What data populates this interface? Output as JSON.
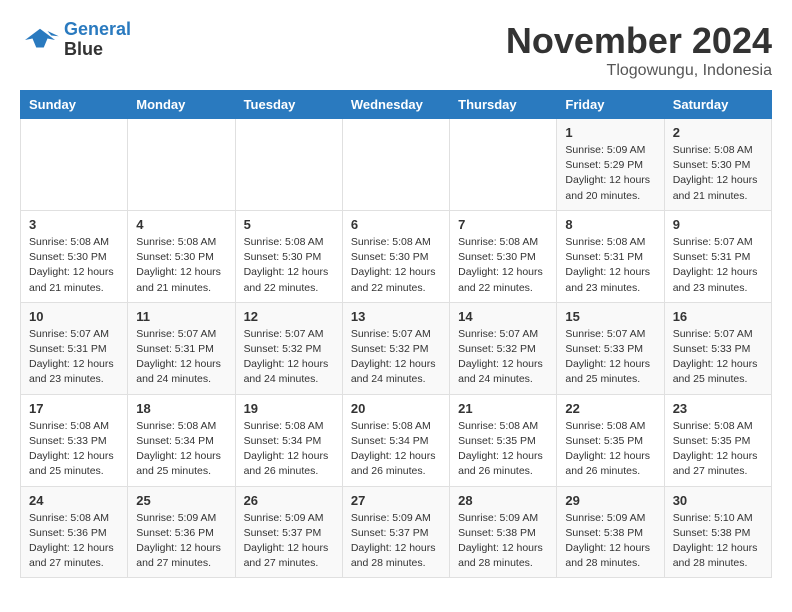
{
  "header": {
    "logo_line1": "General",
    "logo_line2": "Blue",
    "month_title": "November 2024",
    "location": "Tlogowungu, Indonesia"
  },
  "days_of_week": [
    "Sunday",
    "Monday",
    "Tuesday",
    "Wednesday",
    "Thursday",
    "Friday",
    "Saturday"
  ],
  "weeks": [
    {
      "days": [
        {
          "number": "",
          "info": ""
        },
        {
          "number": "",
          "info": ""
        },
        {
          "number": "",
          "info": ""
        },
        {
          "number": "",
          "info": ""
        },
        {
          "number": "",
          "info": ""
        },
        {
          "number": "1",
          "info": "Sunrise: 5:09 AM\nSunset: 5:29 PM\nDaylight: 12 hours\nand 20 minutes."
        },
        {
          "number": "2",
          "info": "Sunrise: 5:08 AM\nSunset: 5:30 PM\nDaylight: 12 hours\nand 21 minutes."
        }
      ]
    },
    {
      "days": [
        {
          "number": "3",
          "info": "Sunrise: 5:08 AM\nSunset: 5:30 PM\nDaylight: 12 hours\nand 21 minutes."
        },
        {
          "number": "4",
          "info": "Sunrise: 5:08 AM\nSunset: 5:30 PM\nDaylight: 12 hours\nand 21 minutes."
        },
        {
          "number": "5",
          "info": "Sunrise: 5:08 AM\nSunset: 5:30 PM\nDaylight: 12 hours\nand 22 minutes."
        },
        {
          "number": "6",
          "info": "Sunrise: 5:08 AM\nSunset: 5:30 PM\nDaylight: 12 hours\nand 22 minutes."
        },
        {
          "number": "7",
          "info": "Sunrise: 5:08 AM\nSunset: 5:30 PM\nDaylight: 12 hours\nand 22 minutes."
        },
        {
          "number": "8",
          "info": "Sunrise: 5:08 AM\nSunset: 5:31 PM\nDaylight: 12 hours\nand 23 minutes."
        },
        {
          "number": "9",
          "info": "Sunrise: 5:07 AM\nSunset: 5:31 PM\nDaylight: 12 hours\nand 23 minutes."
        }
      ]
    },
    {
      "days": [
        {
          "number": "10",
          "info": "Sunrise: 5:07 AM\nSunset: 5:31 PM\nDaylight: 12 hours\nand 23 minutes."
        },
        {
          "number": "11",
          "info": "Sunrise: 5:07 AM\nSunset: 5:31 PM\nDaylight: 12 hours\nand 24 minutes."
        },
        {
          "number": "12",
          "info": "Sunrise: 5:07 AM\nSunset: 5:32 PM\nDaylight: 12 hours\nand 24 minutes."
        },
        {
          "number": "13",
          "info": "Sunrise: 5:07 AM\nSunset: 5:32 PM\nDaylight: 12 hours\nand 24 minutes."
        },
        {
          "number": "14",
          "info": "Sunrise: 5:07 AM\nSunset: 5:32 PM\nDaylight: 12 hours\nand 24 minutes."
        },
        {
          "number": "15",
          "info": "Sunrise: 5:07 AM\nSunset: 5:33 PM\nDaylight: 12 hours\nand 25 minutes."
        },
        {
          "number": "16",
          "info": "Sunrise: 5:07 AM\nSunset: 5:33 PM\nDaylight: 12 hours\nand 25 minutes."
        }
      ]
    },
    {
      "days": [
        {
          "number": "17",
          "info": "Sunrise: 5:08 AM\nSunset: 5:33 PM\nDaylight: 12 hours\nand 25 minutes."
        },
        {
          "number": "18",
          "info": "Sunrise: 5:08 AM\nSunset: 5:34 PM\nDaylight: 12 hours\nand 25 minutes."
        },
        {
          "number": "19",
          "info": "Sunrise: 5:08 AM\nSunset: 5:34 PM\nDaylight: 12 hours\nand 26 minutes."
        },
        {
          "number": "20",
          "info": "Sunrise: 5:08 AM\nSunset: 5:34 PM\nDaylight: 12 hours\nand 26 minutes."
        },
        {
          "number": "21",
          "info": "Sunrise: 5:08 AM\nSunset: 5:35 PM\nDaylight: 12 hours\nand 26 minutes."
        },
        {
          "number": "22",
          "info": "Sunrise: 5:08 AM\nSunset: 5:35 PM\nDaylight: 12 hours\nand 26 minutes."
        },
        {
          "number": "23",
          "info": "Sunrise: 5:08 AM\nSunset: 5:35 PM\nDaylight: 12 hours\nand 27 minutes."
        }
      ]
    },
    {
      "days": [
        {
          "number": "24",
          "info": "Sunrise: 5:08 AM\nSunset: 5:36 PM\nDaylight: 12 hours\nand 27 minutes."
        },
        {
          "number": "25",
          "info": "Sunrise: 5:09 AM\nSunset: 5:36 PM\nDaylight: 12 hours\nand 27 minutes."
        },
        {
          "number": "26",
          "info": "Sunrise: 5:09 AM\nSunset: 5:37 PM\nDaylight: 12 hours\nand 27 minutes."
        },
        {
          "number": "27",
          "info": "Sunrise: 5:09 AM\nSunset: 5:37 PM\nDaylight: 12 hours\nand 28 minutes."
        },
        {
          "number": "28",
          "info": "Sunrise: 5:09 AM\nSunset: 5:38 PM\nDaylight: 12 hours\nand 28 minutes."
        },
        {
          "number": "29",
          "info": "Sunrise: 5:09 AM\nSunset: 5:38 PM\nDaylight: 12 hours\nand 28 minutes."
        },
        {
          "number": "30",
          "info": "Sunrise: 5:10 AM\nSunset: 5:38 PM\nDaylight: 12 hours\nand 28 minutes."
        }
      ]
    }
  ]
}
